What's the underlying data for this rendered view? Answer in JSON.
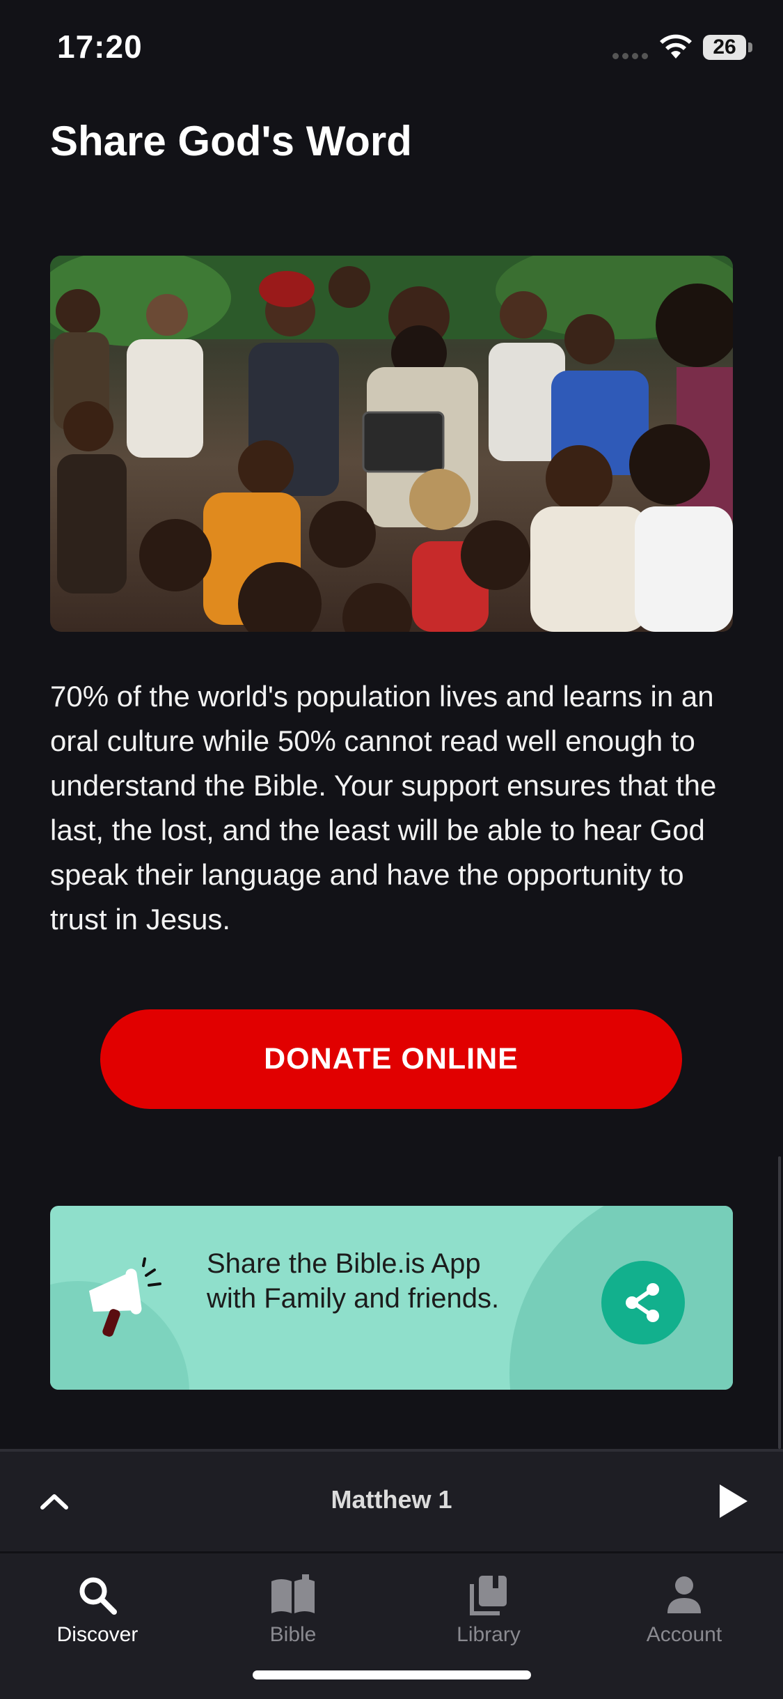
{
  "status_bar": {
    "time": "17:20",
    "battery": "26"
  },
  "page": {
    "title": "Share God's Word",
    "photo_alt": "",
    "body": "70% of the world's population lives and learns in an oral culture while 50% cannot read well enough to understand the Bible. Your support ensures that the last, the lost, and the least will be able to hear God speak their language and have the opportunity to trust in Jesus.",
    "donate_label": "DONATE ONLINE"
  },
  "share_card": {
    "text": "Share the Bible.is App with Family and friends."
  },
  "mini_player": {
    "chapter": "Matthew 1"
  },
  "tabs": [
    {
      "label": "Discover",
      "icon": "search-icon",
      "active": true
    },
    {
      "label": "Bible",
      "icon": "book-icon",
      "active": false
    },
    {
      "label": "Library",
      "icon": "library-icon",
      "active": false
    },
    {
      "label": "Account",
      "icon": "person-icon",
      "active": false
    }
  ],
  "colors": {
    "background": "#121217",
    "donate": "#e10000",
    "share_card": "#8fdfcb",
    "share_button": "#12b08d"
  }
}
